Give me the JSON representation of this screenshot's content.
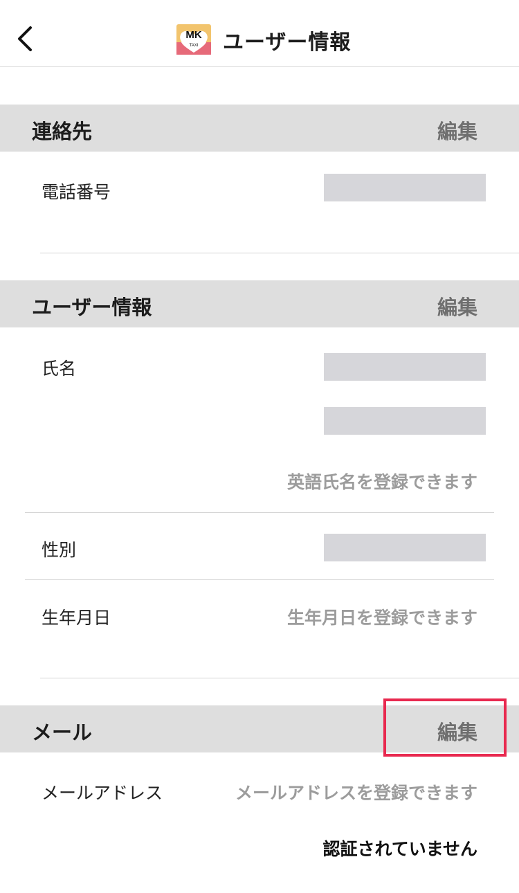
{
  "header": {
    "title": "ユーザー情報",
    "logo_text": "MK",
    "logo_sub": "TAXI"
  },
  "sections": {
    "contact": {
      "title": "連絡先",
      "edit_label": "編集",
      "phone_label": "電話番号"
    },
    "user_info": {
      "title": "ユーザー情報",
      "edit_label": "編集",
      "name_label": "氏名",
      "english_name_hint": "英語氏名を登録できます",
      "gender_label": "性別",
      "birthday_label": "生年月日",
      "birthday_hint": "生年月日を登録できます"
    },
    "mail": {
      "title": "メール",
      "edit_label": "編集",
      "email_label": "メールアドレス",
      "email_hint": "メールアドレスを登録できます",
      "verify_status": "認証されていません"
    }
  },
  "colors": {
    "section_bar": "#dedede",
    "hint_text": "#9c9c9c",
    "highlight": "#e8294f",
    "placeholder_box": "#d6d6da"
  }
}
